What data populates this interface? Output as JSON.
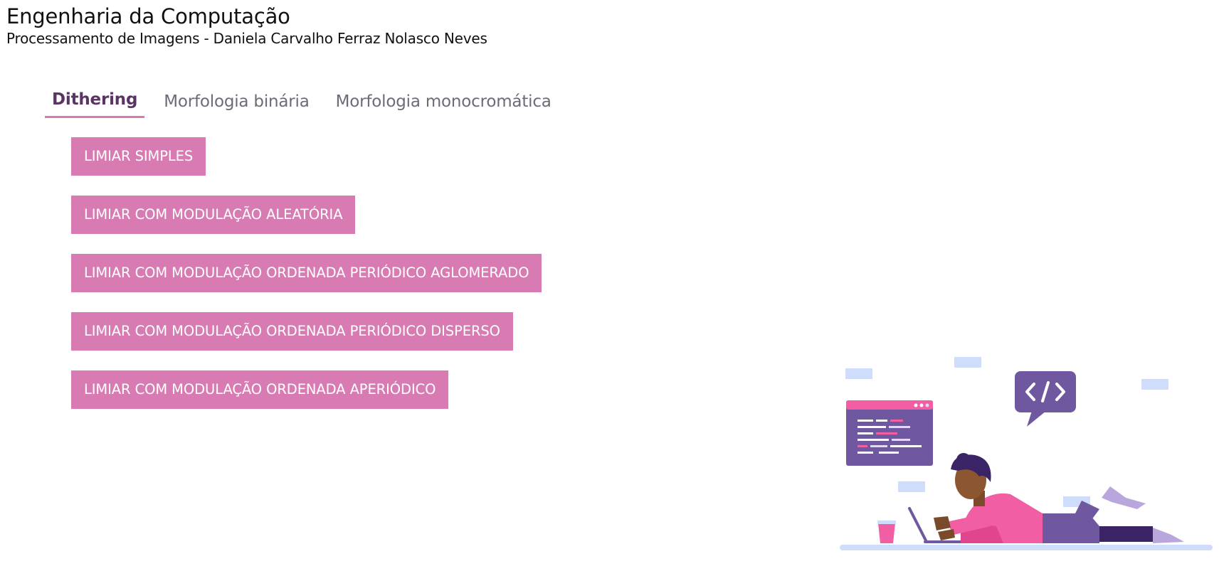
{
  "header": {
    "title": "Engenharia da Computação",
    "subtitle": "Processamento de Imagens - Daniela Carvalho Ferraz Nolasco Neves"
  },
  "tabs": [
    {
      "label": "Dithering",
      "active": true
    },
    {
      "label": "Morfologia binária",
      "active": false
    },
    {
      "label": "Morfologia monocromática",
      "active": false
    }
  ],
  "buttons": [
    {
      "label": "LIMIAR SIMPLES"
    },
    {
      "label": "LIMIAR COM MODULAÇÃO ALEATÓRIA"
    },
    {
      "label": "LIMIAR COM MODULAÇÃO ORDENADA PERIÓDICO AGLOMERADO"
    },
    {
      "label": "LIMIAR COM MODULAÇÃO ORDENADA PERIÓDICO DISPERSO"
    },
    {
      "label": "LIMIAR COM MODULAÇÃO ORDENADA APERIÓDICO"
    }
  ],
  "colors": {
    "accent": "#d97bb3",
    "active_tab_text": "#5a3563",
    "tab_text": "#6f6a78",
    "illustration_purple": "#6f58a0",
    "illustration_pink": "#f25ea3",
    "illustration_light_blue": "#cfdcfb"
  }
}
